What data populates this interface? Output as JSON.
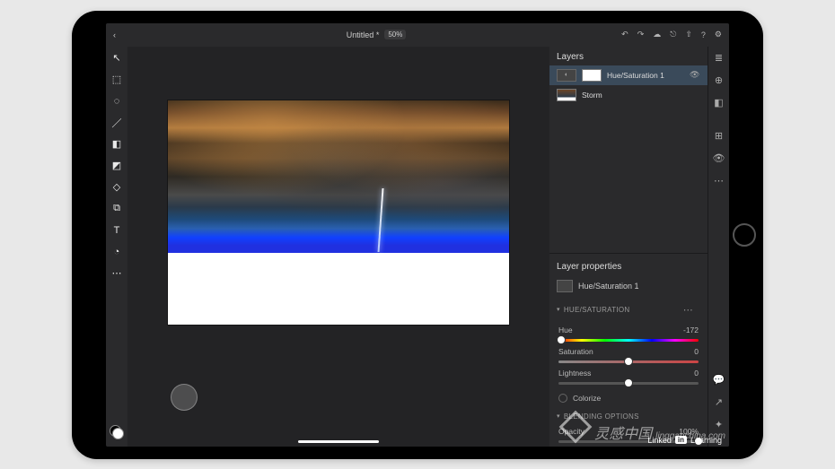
{
  "topbar": {
    "title": "Untitled *",
    "zoom": "50%"
  },
  "tools": [
    {
      "name": "select-tool",
      "glyph": "↖"
    },
    {
      "name": "marquee-tool",
      "glyph": "⬚"
    },
    {
      "name": "lasso-tool",
      "glyph": "◌"
    },
    {
      "name": "brush-tool",
      "glyph": "／"
    },
    {
      "name": "eraser-tool",
      "glyph": "◧"
    },
    {
      "name": "gradient-tool",
      "glyph": "◩"
    },
    {
      "name": "shape-tool",
      "glyph": "◇"
    },
    {
      "name": "crop-tool",
      "glyph": "⧉"
    },
    {
      "name": "text-tool",
      "glyph": "T"
    },
    {
      "name": "eyedrop-tool",
      "glyph": "◔"
    },
    {
      "name": "more-tool",
      "glyph": "⋯"
    }
  ],
  "layers": {
    "heading": "Layers",
    "items": [
      {
        "name": "Hue/Saturation 1",
        "type": "adjustment",
        "selected": true
      },
      {
        "name": "Storm",
        "type": "image",
        "selected": false
      }
    ]
  },
  "layer_properties": {
    "heading": "Layer properties",
    "name": "Hue/Saturation 1",
    "section_hs": {
      "heading": "HUE/SATURATION",
      "hue": {
        "label": "Hue",
        "value": -172,
        "knob_pct": 2
      },
      "saturation": {
        "label": "Saturation",
        "value": 0,
        "knob_pct": 50
      },
      "lightness": {
        "label": "Lightness",
        "value": 0,
        "knob_pct": 50
      },
      "colorize": {
        "label": "Colorize",
        "checked": false
      }
    },
    "section_blend": {
      "heading": "BLENDING OPTIONS",
      "opacity": {
        "label": "Opacity",
        "value": "100%",
        "knob_pct": 100
      }
    }
  },
  "watermark": {
    "main": "灵感中国",
    "sub": "lingganchina.com"
  },
  "linkedin": {
    "brand": "Linked",
    "box": "in",
    "tail": "Learning"
  }
}
